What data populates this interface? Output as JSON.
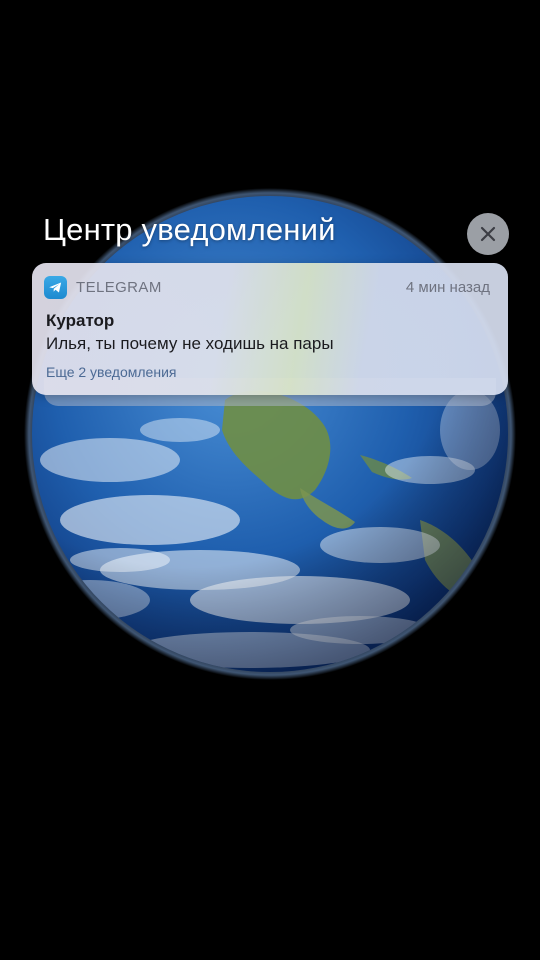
{
  "header": {
    "title": "Центр уведомлений",
    "close_icon": "close-x-icon"
  },
  "notification": {
    "app_icon": "telegram-plane-icon",
    "app_name": "TELEGRAM",
    "time": "4 мин назад",
    "sender": "Куратор",
    "message": "Илья, ты почему не ходишь на пары",
    "more_label": "Еще 2 уведомления"
  },
  "wallpaper": {
    "subject": "earth-globe-wallpaper",
    "colors": {
      "background": "#000000",
      "ocean": "#1f5fae",
      "land": "#6f8e45"
    }
  }
}
